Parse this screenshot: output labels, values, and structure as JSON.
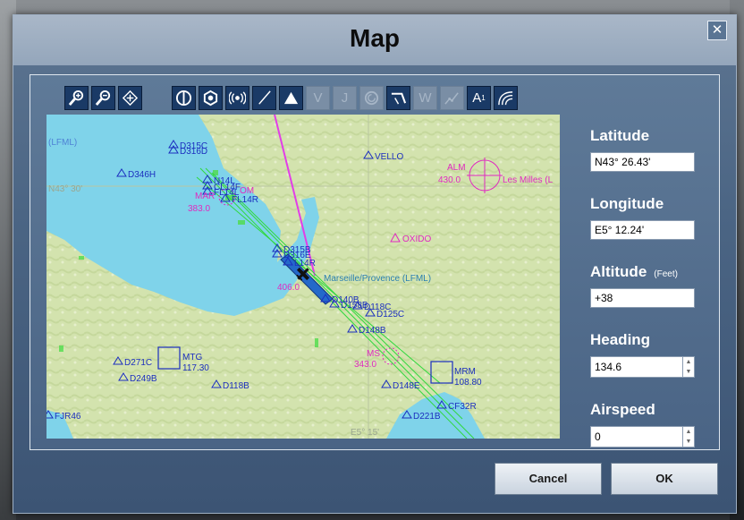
{
  "window": {
    "title": "Map",
    "close_label": "✕"
  },
  "toolbar": {
    "zoom_group": [
      {
        "name": "zoom-in-icon",
        "enabled": true
      },
      {
        "name": "zoom-out-icon",
        "enabled": true
      },
      {
        "name": "center-aircraft-icon",
        "enabled": true
      }
    ],
    "layer_group": [
      {
        "name": "vor-icon",
        "enabled": true
      },
      {
        "name": "ndb-icon",
        "enabled": true
      },
      {
        "name": "ils-icon",
        "enabled": true
      },
      {
        "name": "localizer-icon",
        "enabled": true
      },
      {
        "name": "intersection-icon",
        "enabled": true
      },
      {
        "name": "victor-airways-icon",
        "label": "V",
        "enabled": false
      },
      {
        "name": "jet-airways-icon",
        "label": "J",
        "enabled": false
      },
      {
        "name": "holding-pattern-icon",
        "enabled": false
      },
      {
        "name": "approach-icon",
        "enabled": true
      },
      {
        "name": "waypoint-icon",
        "label": "W",
        "enabled": false
      },
      {
        "name": "flight-path-icon",
        "enabled": false
      },
      {
        "name": "airport-labels-icon",
        "label": "A",
        "enabled": true
      },
      {
        "name": "terrain-icon",
        "enabled": true
      }
    ]
  },
  "fields": {
    "latitude": {
      "label": "Latitude",
      "value": "N43° 26.43'"
    },
    "longitude": {
      "label": "Longitude",
      "value": "E5° 12.24'"
    },
    "altitude": {
      "label": "Altitude",
      "unit": "(Feet)",
      "value": "+38"
    },
    "heading": {
      "label": "Heading",
      "value": "134.6"
    },
    "airspeed": {
      "label": "Airspeed",
      "value": "0"
    }
  },
  "buttons": {
    "cancel": "Cancel",
    "ok": "OK"
  },
  "map": {
    "grid_labels": {
      "lat": "N43° 30'",
      "lon": "E5° 15'"
    },
    "airport_left": "(LFML)",
    "airport_name": "Marseille/Provence (LFML)",
    "waypoints": [
      "D315C",
      "D316D",
      "D346H",
      "VELLO",
      "N14L",
      "CL14F",
      "FL14L",
      "FL14R",
      "D315B",
      "D316E",
      "L14R",
      "D140B",
      "D158B",
      "D118C",
      "D125C",
      "D148B",
      "D271C",
      "D249B",
      "D118B",
      "D148E",
      "D221B",
      "CF32R",
      "FJR46"
    ],
    "navaids": [
      {
        "id": "ALM",
        "freq": "430.0",
        "name": "Les Milles (L"
      },
      {
        "id": "MAR",
        "freq": "383.0",
        "name": "OM"
      },
      {
        "id": "MS",
        "freq": "343.0"
      },
      {
        "id": "MTG",
        "freq": "117.30"
      },
      {
        "id": "MRM",
        "freq": "108.80"
      },
      {
        "id": "OXIDO"
      },
      {
        "id": "aircraft_freq",
        "freq": "406.0"
      }
    ],
    "colors": {
      "water": "#7fd3ea",
      "land": "#d7e6b4",
      "route": "#2fd83d",
      "waypoint": "#1c2fbf",
      "navaid": "#e02ac0",
      "flightline": "#e23ee8"
    }
  }
}
